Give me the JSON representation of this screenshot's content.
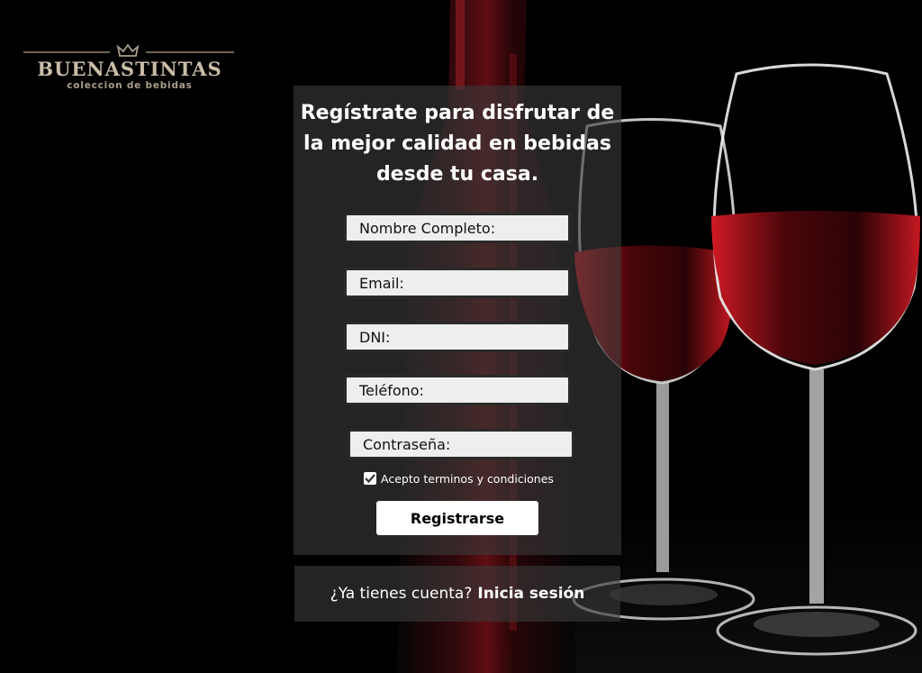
{
  "brand": {
    "name": "BUENASTINTAS",
    "tagline": "coleccion de bebidas"
  },
  "form": {
    "heading": "Regístrate para disfrutar de la mejor calidad en bebidas desde tu casa.",
    "fields": {
      "name_placeholder": "Nombre Completo:",
      "email_placeholder": "Email:",
      "dni_placeholder": "DNI:",
      "phone_placeholder": "Teléfono:",
      "password_placeholder": "Contraseña:"
    },
    "terms_label": "Acepto terminos y condiciones",
    "terms_checked": true,
    "submit_label": "Registrarse"
  },
  "login": {
    "prompt": "¿Ya tienes cuenta?",
    "link_label": "Inicia sesión"
  },
  "colors": {
    "background": "#000000",
    "wine": "#b3121c",
    "brand_gold": "#c9bda8"
  }
}
